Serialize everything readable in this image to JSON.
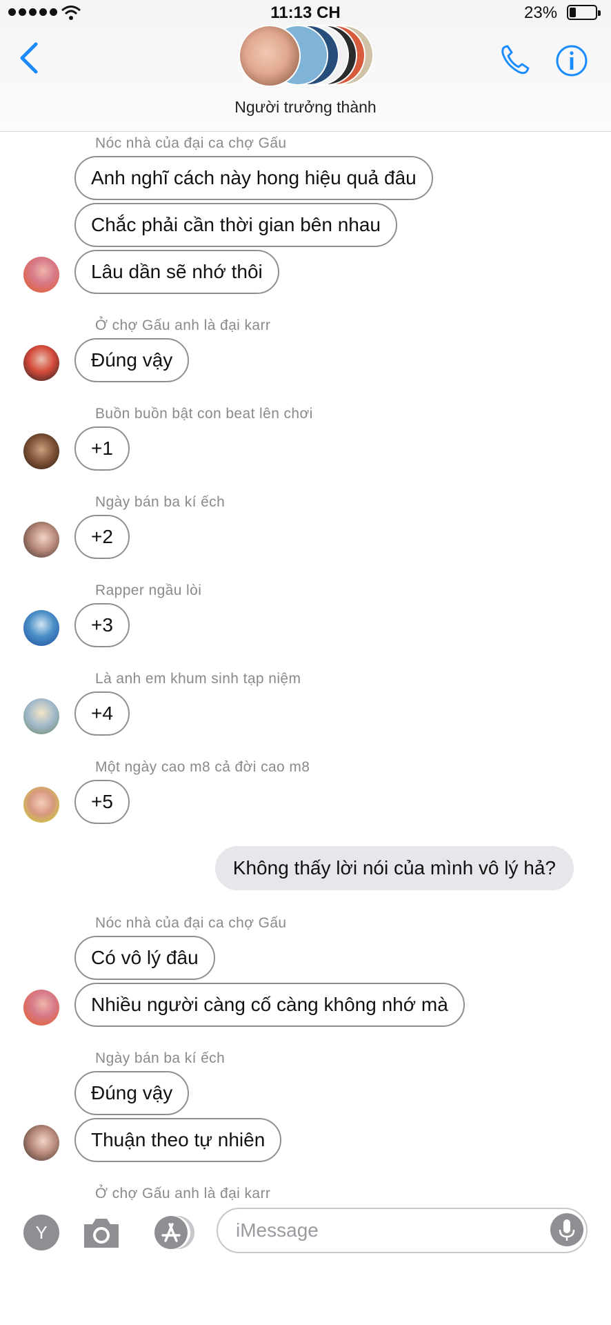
{
  "status_bar": {
    "time": "11:13 CH",
    "battery": "23%"
  },
  "header": {
    "group_name": "Người trưởng thành"
  },
  "messages": [
    {
      "sender": "Nóc nhà của đại ca chợ Gấu",
      "bubbles": [
        "Anh nghĩ cách này hong hiệu quả đâu",
        "Chắc phải cần thời gian bên nhau",
        "Lâu dần sẽ nhớ thôi"
      ]
    },
    {
      "sender": "Ở chợ Gấu anh là đại karr",
      "bubbles": [
        "Đúng vậy"
      ]
    },
    {
      "sender": "Buồn buồn bật con beat lên chơi",
      "bubbles": [
        "+1"
      ]
    },
    {
      "sender": "Ngày bán ba kí ếch",
      "bubbles": [
        "+2"
      ]
    },
    {
      "sender": "Rapper ngầu lòi",
      "bubbles": [
        "+3"
      ]
    },
    {
      "sender": "Là anh em khum sinh tạp niệm",
      "bubbles": [
        "+4"
      ]
    },
    {
      "sender": "Một ngày cao m8 cả đời cao m8",
      "bubbles": [
        "+5"
      ]
    },
    {
      "outgoing": "Không thấy lời nói của mình vô lý hả?"
    },
    {
      "sender": "Nóc nhà của đại ca chợ Gấu",
      "bubbles": [
        "Có vô lý đâu",
        "Nhiều người càng cố càng không nhớ mà"
      ]
    },
    {
      "sender": "Ngày bán ba kí ếch",
      "bubbles": [
        "Đúng vậy",
        "Thuận theo tự nhiên"
      ]
    },
    {
      "sender": "Ở chợ Gấu anh là đại karr"
    }
  ],
  "composer": {
    "placeholder": "iMessage",
    "apps_label": "Y"
  },
  "colors": {
    "accent": "#1a8cff",
    "bubble_outgoing": "#e6e6eb",
    "bubble_border": "#8e8e93",
    "sender_text": "#8a8a8e"
  }
}
